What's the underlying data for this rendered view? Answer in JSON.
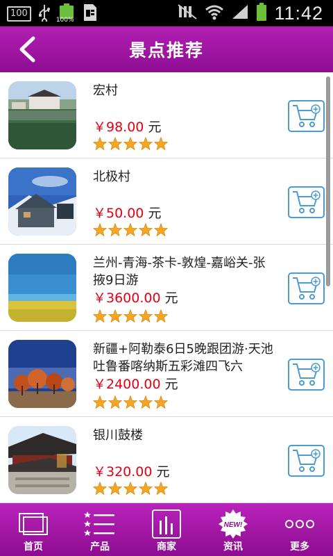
{
  "status_bar": {
    "badge": "100",
    "battery_percent": "100%",
    "time": "11:42"
  },
  "header": {
    "title": "景点推荐",
    "back_icon": "chevron-left-icon"
  },
  "colors": {
    "accent": "#a016a3",
    "price": "#e60012",
    "star": "#f5a623",
    "cart": "#4a9bd1"
  },
  "items": [
    {
      "name": "宏村",
      "price": "￥98.00",
      "unit": "元",
      "rating": 5
    },
    {
      "name": "北极村",
      "price": "￥50.00",
      "unit": "元",
      "rating": 5
    },
    {
      "name": "兰州-青海-茶卡-敦煌-嘉峪关-张掖9日游",
      "price": "￥3600.00",
      "unit": "元",
      "rating": 5
    },
    {
      "name": "新疆+阿勒泰6日5晚跟团游·天池吐鲁番喀纳斯五彩滩四飞六",
      "price": "￥2400.00",
      "unit": "元",
      "rating": 5
    },
    {
      "name": "银川鼓楼",
      "price": "￥320.00",
      "unit": "元",
      "rating": 5
    }
  ],
  "nav": [
    {
      "label": "首页",
      "icon": "home-icon"
    },
    {
      "label": "产品",
      "icon": "list-icon"
    },
    {
      "label": "商家",
      "icon": "store-icon"
    },
    {
      "label": "资讯",
      "icon": "new-badge-icon",
      "badge": "NEW!"
    },
    {
      "label": "更多",
      "icon": "more-icon"
    }
  ]
}
